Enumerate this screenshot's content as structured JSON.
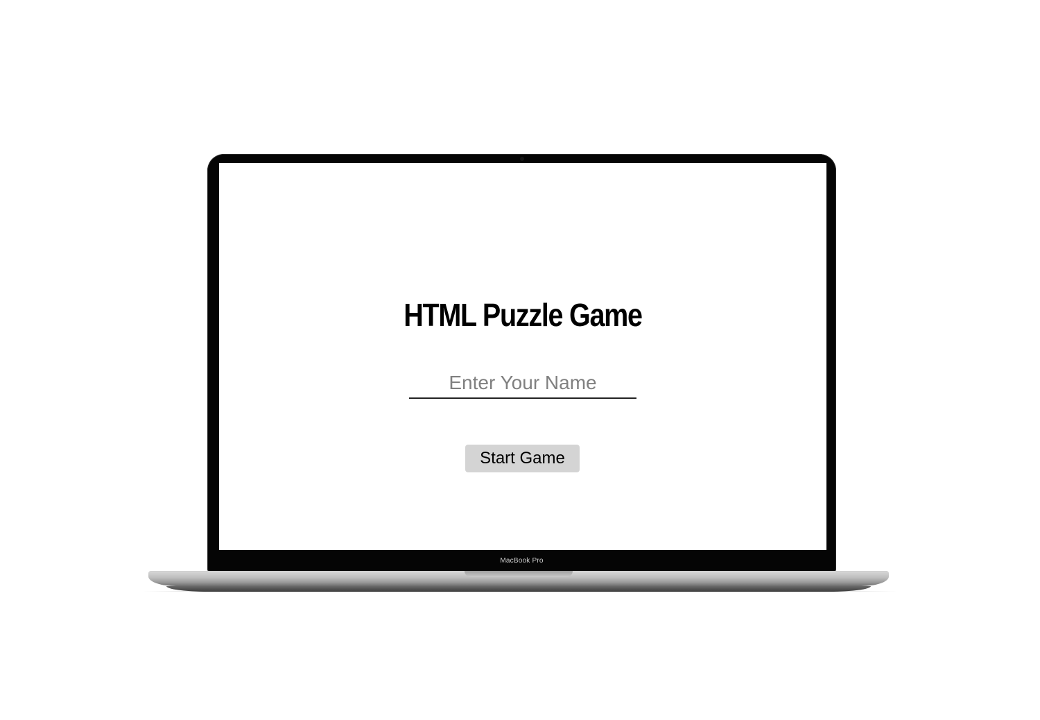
{
  "device": {
    "label": "MacBook Pro"
  },
  "game": {
    "title": "HTML Puzzle Game",
    "name_input": {
      "placeholder": "Enter Your Name",
      "value": ""
    },
    "start_button_label": "Start Game"
  },
  "colors": {
    "background": "#ffffff",
    "bezel": "#050505",
    "title_text": "#000000",
    "placeholder_text": "#808080",
    "input_underline": "#222222",
    "button_background": "#d4d4d4",
    "button_text": "#000000"
  }
}
